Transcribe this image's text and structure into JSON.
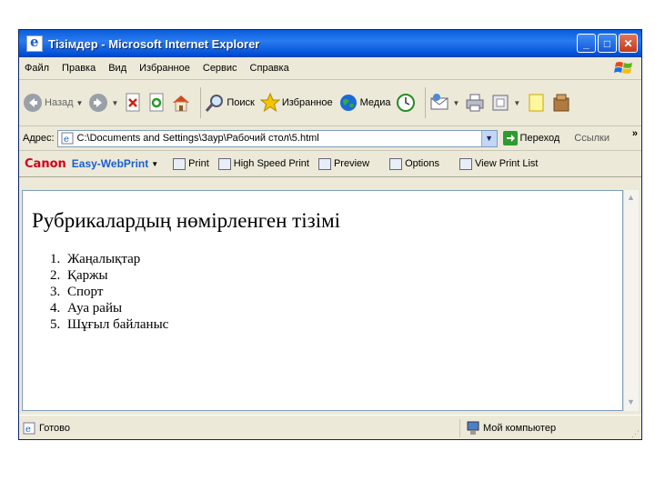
{
  "window": {
    "title": "Тізімдер - Microsoft Internet Explorer"
  },
  "menu": [
    "Файл",
    "Правка",
    "Вид",
    "Избранное",
    "Сервис",
    "Справка"
  ],
  "toolbar": {
    "back": "Назад",
    "search": "Поиск",
    "favorites": "Избранное",
    "media": "Медиа"
  },
  "address": {
    "label": "Адрес:",
    "url": "C:\\Documents and Settings\\Заур\\Рабочий стол\\5.html",
    "go": "Переход",
    "links": "Ссылки",
    "more": "»"
  },
  "canon": {
    "logo": "Canon",
    "product": "Easy-WebPrint",
    "print": "Print",
    "high_speed": "High Speed Print",
    "preview": "Preview",
    "options": "Options",
    "view_list": "View Print List"
  },
  "page": {
    "heading": "Рубрикалардың нөмірленген тізімі",
    "items": [
      "Жаңалықтар",
      "Қаржы",
      "Спорт",
      "Ауа райы",
      "Шұғыл байланыс"
    ]
  },
  "status": {
    "left": "Готово",
    "zone": "Мой компьютер"
  }
}
